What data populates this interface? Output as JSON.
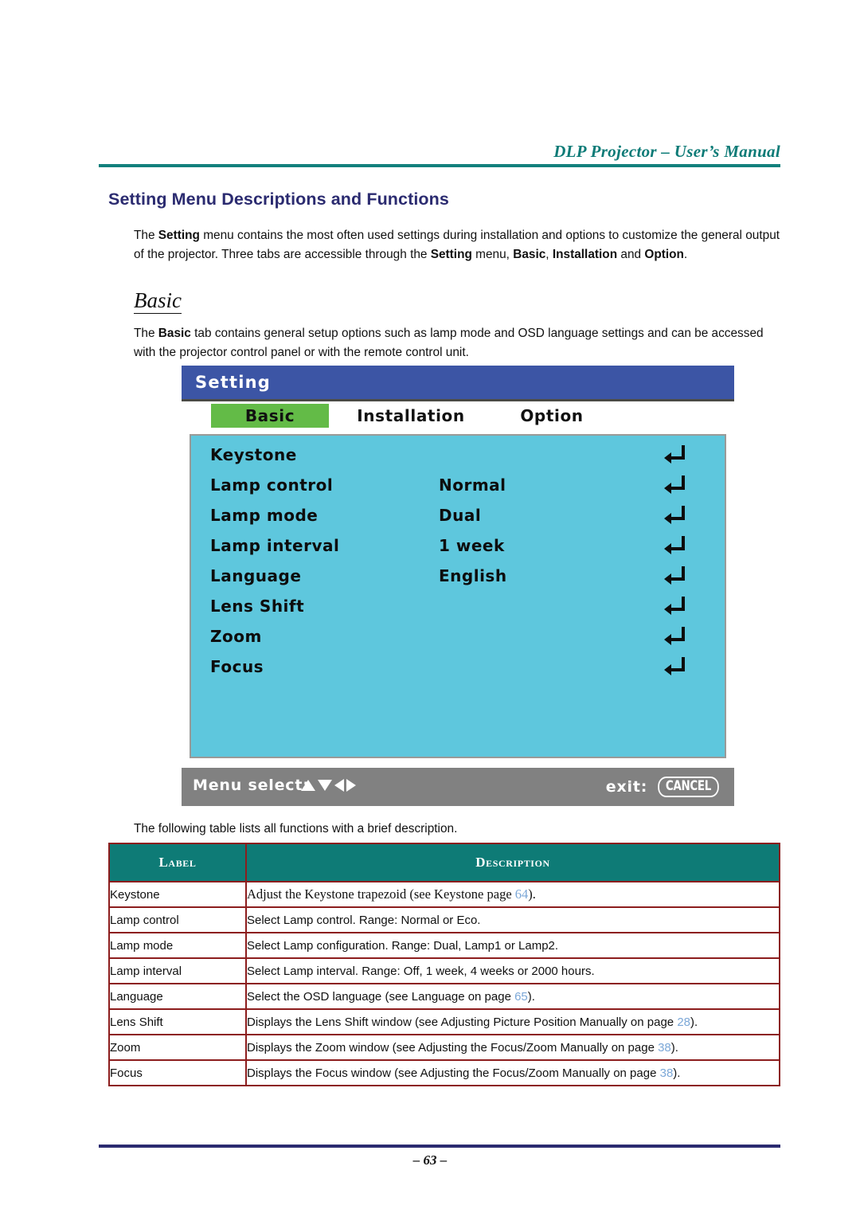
{
  "header": {
    "manual_title": "DLP Projector – User’s Manual"
  },
  "section": {
    "title": "Setting Menu Descriptions and Functions",
    "intro_paragraph": "The Setting menu contains the most often used settings during installation and options to customize the general output of the projector. Three tabs are accessible through the Setting menu, Basic, Installation and Option.",
    "sub_heading": "Basic",
    "basic_paragraph": "The Basic tab contains general setup options such as lamp mode and OSD language settings and can be accessed with the projector control panel or with the remote control unit.",
    "table_intro": "The following table lists all functions with a brief description."
  },
  "osd": {
    "title": "Setting",
    "tabs": [
      {
        "label": "Basic",
        "selected": true
      },
      {
        "label": "Installation",
        "selected": false
      },
      {
        "label": "Option",
        "selected": false
      }
    ],
    "rows": [
      {
        "label": "Keystone",
        "value": "",
        "enter_icon": "enter-arrow-icon"
      },
      {
        "label": "Lamp control",
        "value": "Normal",
        "enter_icon": "enter-arrow-icon"
      },
      {
        "label": "Lamp mode",
        "value": "Dual",
        "enter_icon": "enter-arrow-icon"
      },
      {
        "label": "Lamp interval",
        "value": "1 week",
        "enter_icon": "enter-arrow-icon"
      },
      {
        "label": "Language",
        "value": "English",
        "enter_icon": "enter-arrow-icon"
      },
      {
        "label": "Lens Shift",
        "value": "",
        "enter_icon": "enter-arrow-icon"
      },
      {
        "label": "Zoom",
        "value": "",
        "enter_icon": "enter-arrow-icon"
      },
      {
        "label": "Focus",
        "value": "",
        "enter_icon": "enter-arrow-icon"
      }
    ],
    "footer": {
      "menu_select_label": "Menu select:",
      "arrows": [
        "up-triangle-icon",
        "down-triangle-icon",
        "left-triangle-icon",
        "right-triangle-icon"
      ],
      "exit_label": "exit:",
      "exit_button": "CANCEL"
    },
    "colors": {
      "titlebar": "#3c55a5",
      "tab_selected": "#63bb47",
      "body": "#5ec7dd",
      "footer": "#818181"
    }
  },
  "table": {
    "headers": [
      "Label",
      "Description"
    ],
    "rows": [
      {
        "label": "Keystone",
        "desc_pre": "Adjust the Keystone trapezoid (see Keystone page ",
        "page": "64",
        "desc_post": ").",
        "serif": true
      },
      {
        "label": "Lamp control",
        "desc_pre": "Select Lamp control. Range: Normal or Eco.",
        "page": "",
        "desc_post": "",
        "serif": false
      },
      {
        "label": "Lamp mode",
        "desc_pre": "Select Lamp configuration. Range: Dual, Lamp1 or Lamp2.",
        "page": "",
        "desc_post": "",
        "serif": false
      },
      {
        "label": "Lamp interval",
        "desc_pre": "Select Lamp interval. Range: Off, 1 week, 4 weeks or 2000 hours.",
        "page": "",
        "desc_post": "",
        "serif": false
      },
      {
        "label": "Language",
        "desc_pre": "Select the OSD language (see Language on page ",
        "page": "65",
        "desc_post": ").",
        "serif": false
      },
      {
        "label": "Lens Shift",
        "desc_pre": "Displays the Lens Shift window (see Adjusting Picture Position Manually on page ",
        "page": "28",
        "desc_post": ").",
        "serif": false
      },
      {
        "label": "Zoom",
        "desc_pre": "Displays the Zoom window (see Adjusting the Focus/Zoom Manually on page ",
        "page": "38",
        "desc_post": ").",
        "serif": false
      },
      {
        "label": "Focus",
        "desc_pre": "Displays the Focus window (see Adjusting the Focus/Zoom Manually on page ",
        "page": "38",
        "desc_post": ").",
        "serif": false
      }
    ],
    "colors": {
      "header_bg": "#0e7b76",
      "border": "#8c1d1d",
      "page_link": "#7ba7d7"
    }
  },
  "footer": {
    "page_number": "– 63 –"
  }
}
